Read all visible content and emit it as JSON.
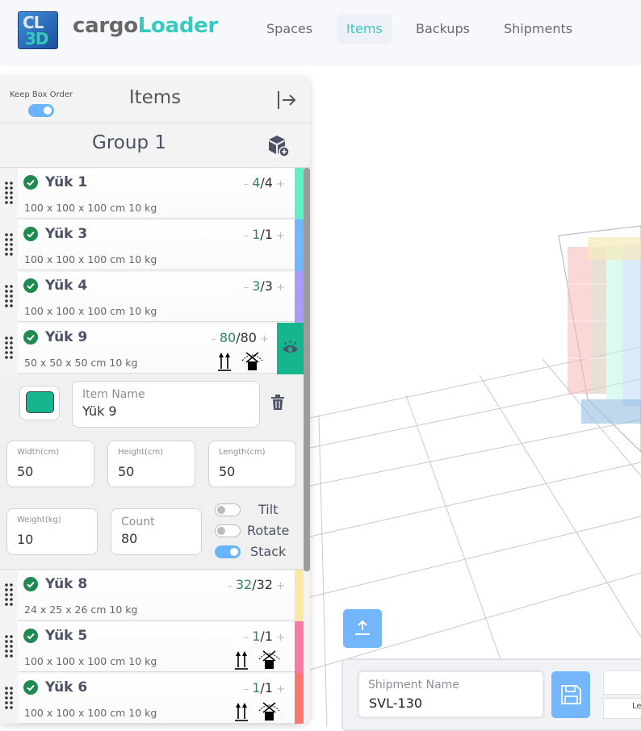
{
  "app": {
    "logo_text_top": "CL",
    "logo_text_bottom": "3D",
    "brand_part1": "cargo",
    "brand_part2": "Loader"
  },
  "nav": {
    "items": [
      {
        "label": "Spaces",
        "active": false
      },
      {
        "label": "Items",
        "active": true
      },
      {
        "label": "Backups",
        "active": false
      },
      {
        "label": "Shipments",
        "active": false
      }
    ]
  },
  "panel": {
    "keep_box_order_label": "Keep Box Order",
    "keep_box_order_on": true,
    "title": "Items",
    "group_title": "Group 1"
  },
  "items": [
    {
      "name": "Yük 1",
      "dims": "100 x 100 x 100 cm 10 kg",
      "placed": "4",
      "total": "4",
      "color": "#5ef2c6",
      "flags": false
    },
    {
      "name": "Yük 3",
      "dims": "100 x 100 x 100 cm 10 kg",
      "placed": "1",
      "total": "1",
      "color": "#74b6fb",
      "flags": false
    },
    {
      "name": "Yük 4",
      "dims": "100 x 100 x 100 cm 10 kg",
      "placed": "3",
      "total": "3",
      "color": "#a79cf6",
      "flags": false
    },
    {
      "name": "Yük 9",
      "dims": "50 x 50 x 50 cm 10 kg",
      "placed": "80",
      "total": "80",
      "color": "#14b58f",
      "flags": true,
      "selected": true
    },
    {
      "name": "Yük 8",
      "dims": "24 x 25 x 26 cm 10 kg",
      "placed": "32",
      "total": "32",
      "color": "#fde7a4",
      "flags": false
    },
    {
      "name": "Yük 5",
      "dims": "100 x 100 x 100 cm 10 kg",
      "placed": "1",
      "total": "1",
      "color": "#f879a8",
      "flags": true
    },
    {
      "name": "Yük 6",
      "dims": "100 x 100 x 100 cm 10 kg",
      "placed": "1",
      "total": "1",
      "color": "#fb7671",
      "flags": true
    }
  ],
  "editor": {
    "color": "#14b58f",
    "item_name_label": "Item Name",
    "item_name_value": "Yük 9",
    "width_label": "Width(cm)",
    "width_value": "50",
    "height_label": "Height(cm)",
    "height_value": "50",
    "length_label": "Length(cm)",
    "length_value": "50",
    "weight_label": "Weight(kg)",
    "weight_value": "10",
    "count_label": "Count",
    "count_value": "80",
    "tilt_label": "Tilt",
    "tilt_on": false,
    "rotate_label": "Rotate",
    "rotate_on": false,
    "stack_label": "Stack",
    "stack_on": true
  },
  "shipment": {
    "name_label": "Shipment Name",
    "name_value": "SVL-130",
    "partial_label": "Le"
  }
}
